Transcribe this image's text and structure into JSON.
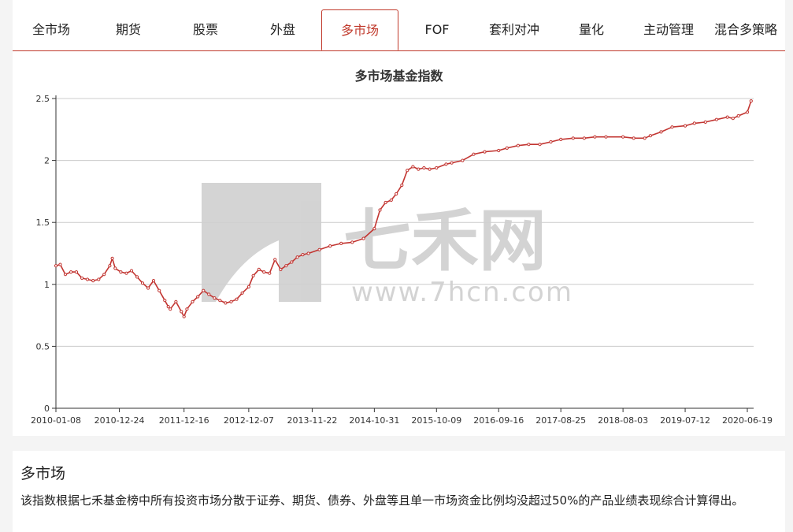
{
  "tabs": [
    {
      "label": "全市场"
    },
    {
      "label": "期货"
    },
    {
      "label": "股票"
    },
    {
      "label": "外盘"
    },
    {
      "label": "多市场"
    },
    {
      "label": "FOF"
    },
    {
      "label": "套利对冲"
    },
    {
      "label": "量化"
    },
    {
      "label": "主动管理"
    },
    {
      "label": "混合多策略"
    }
  ],
  "active_tab": "多市场",
  "watermark": {
    "brand": "七禾网",
    "url": "www.7hcn.com"
  },
  "colors": {
    "accent": "#c0392b",
    "line": "#c23531",
    "grid": "#cccccc",
    "watermark": "#cfcfcf"
  },
  "chart_data": {
    "type": "line",
    "title": "多市场基金指数",
    "xlabel": "",
    "ylabel": "",
    "ylim": [
      0,
      2.5
    ],
    "yticks": [
      "0",
      "0.5",
      "1",
      "1.5",
      "2",
      "2.5"
    ],
    "xticks": [
      "2010-01-08",
      "2010-12-24",
      "2011-12-16",
      "2012-12-07",
      "2013-11-22",
      "2014-10-31",
      "2015-10-09",
      "2016-09-16",
      "2017-08-25",
      "2018-08-03",
      "2019-07-12",
      "2020-06-19"
    ],
    "grid": true,
    "legend": "none",
    "series": [
      {
        "x": [
          "2010-01-08",
          "2010-02-01",
          "2010-03-01",
          "2010-04-01",
          "2010-05-01",
          "2010-06-01",
          "2010-07-01",
          "2010-08-01",
          "2010-09-01",
          "2010-10-01",
          "2010-11-01",
          "2010-11-15",
          "2010-12-01",
          "2011-01-01",
          "2011-02-01",
          "2011-03-01",
          "2011-04-01",
          "2011-05-01",
          "2011-06-01",
          "2011-07-01",
          "2011-08-01",
          "2011-09-01",
          "2011-09-20",
          "2011-10-01",
          "2011-11-01",
          "2011-12-01",
          "2011-12-16",
          "2012-01-01",
          "2012-02-01",
          "2012-03-01",
          "2012-04-01",
          "2012-05-01",
          "2012-06-01",
          "2012-07-01",
          "2012-08-01",
          "2012-09-01",
          "2012-10-01",
          "2012-11-01",
          "2012-12-07",
          "2013-01-01",
          "2013-02-01",
          "2013-03-01",
          "2013-04-01",
          "2013-05-01",
          "2013-06-01",
          "2013-07-01",
          "2013-08-01",
          "2013-09-01",
          "2013-10-01",
          "2013-11-01",
          "2014-01-01",
          "2014-03-01",
          "2014-05-01",
          "2014-07-01",
          "2014-09-01",
          "2014-10-31",
          "2014-12-01",
          "2015-01-01",
          "2015-02-01",
          "2015-03-01",
          "2015-04-01",
          "2015-05-01",
          "2015-06-01",
          "2015-07-01",
          "2015-08-01",
          "2015-09-01",
          "2015-10-09",
          "2015-12-01",
          "2016-01-01",
          "2016-03-01",
          "2016-05-01",
          "2016-07-01",
          "2016-09-16",
          "2016-11-01",
          "2017-01-01",
          "2017-03-01",
          "2017-05-01",
          "2017-07-01",
          "2017-08-25",
          "2017-11-01",
          "2018-01-01",
          "2018-03-01",
          "2018-05-01",
          "2018-08-03",
          "2018-10-01",
          "2018-12-01",
          "2019-01-01",
          "2019-03-01",
          "2019-05-01",
          "2019-07-12",
          "2019-09-01",
          "2019-11-01",
          "2020-01-01",
          "2020-03-01",
          "2020-04-01",
          "2020-05-01",
          "2020-06-19",
          "2020-07-10"
        ],
        "y": [
          1.15,
          1.16,
          1.08,
          1.1,
          1.1,
          1.05,
          1.04,
          1.03,
          1.04,
          1.08,
          1.15,
          1.21,
          1.13,
          1.1,
          1.09,
          1.11,
          1.06,
          1.01,
          0.97,
          1.03,
          0.95,
          0.87,
          0.82,
          0.8,
          0.86,
          0.78,
          0.74,
          0.8,
          0.86,
          0.9,
          0.95,
          0.92,
          0.89,
          0.87,
          0.85,
          0.86,
          0.88,
          0.93,
          0.98,
          1.07,
          1.12,
          1.1,
          1.09,
          1.2,
          1.12,
          1.15,
          1.18,
          1.22,
          1.24,
          1.25,
          1.28,
          1.31,
          1.33,
          1.34,
          1.37,
          1.45,
          1.6,
          1.66,
          1.68,
          1.73,
          1.8,
          1.92,
          1.95,
          1.93,
          1.94,
          1.93,
          1.94,
          1.97,
          1.98,
          2.0,
          2.05,
          2.07,
          2.08,
          2.1,
          2.12,
          2.13,
          2.13,
          2.15,
          2.17,
          2.18,
          2.18,
          2.19,
          2.19,
          2.19,
          2.18,
          2.18,
          2.2,
          2.23,
          2.27,
          2.28,
          2.3,
          2.31,
          2.33,
          2.35,
          2.34,
          2.36,
          2.39,
          2.48
        ]
      }
    ]
  },
  "description": {
    "title": "多市场",
    "text": "该指数根据七禾基金榜中所有投资市场分散于证券、期货、债券、外盘等且单一市场资金比例均没超过50%的产品业绩表现综合计算得出。"
  }
}
